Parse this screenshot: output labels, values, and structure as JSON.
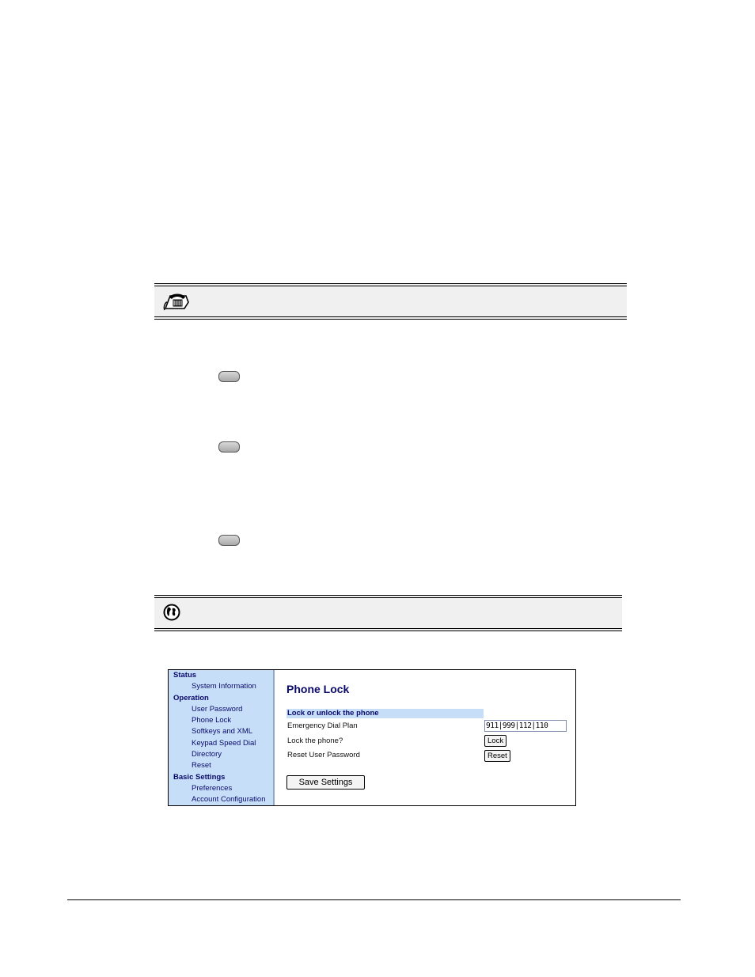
{
  "icons": {
    "phone_note": "phone-icon",
    "web_note": "globe-icon",
    "key": "softkey-button-icon"
  },
  "webui": {
    "sidebar": {
      "sections": [
        {
          "label": "Status",
          "items": [
            "System Information"
          ]
        },
        {
          "label": "Operation",
          "items": [
            "User Password",
            "Phone Lock",
            "Softkeys and XML",
            "Keypad Speed Dial",
            "Directory",
            "Reset"
          ]
        },
        {
          "label": "Basic Settings",
          "items": [
            "Preferences",
            "Account Configuration"
          ]
        }
      ]
    },
    "page_title": "Phone Lock",
    "section_title": "Lock or unlock the phone",
    "emergency_label": "Emergency Dial Plan",
    "emergency_value": "911|999|112|110",
    "lock_label": "Lock the phone?",
    "lock_button": "Lock",
    "reset_label": "Reset User Password",
    "reset_button": "Reset",
    "save_button": "Save Settings"
  }
}
